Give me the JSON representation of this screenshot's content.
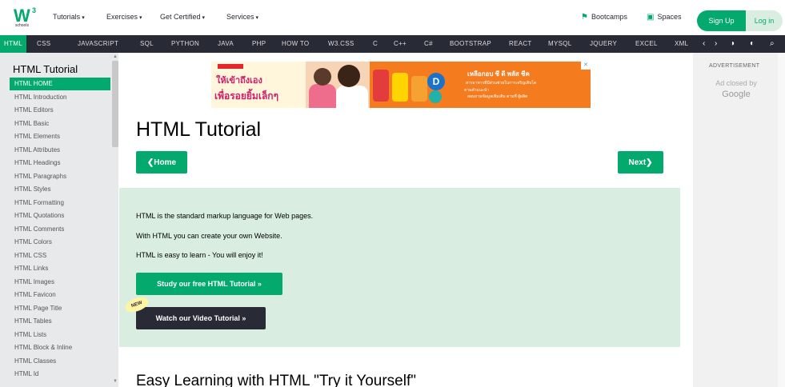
{
  "header": {
    "logo": {
      "text": "W",
      "sup": "3",
      "sub": "schools"
    },
    "menus": [
      {
        "label": "Tutorials",
        "caret": "▾"
      },
      {
        "label": "Exercises",
        "caret": "▾"
      },
      {
        "label": "Get Certified",
        "caret": "▾"
      },
      {
        "label": "Services",
        "caret": "▾"
      }
    ],
    "bootcamps": "Bootcamps",
    "spaces": "Spaces",
    "signup": "Sign Up",
    "login": "Log in"
  },
  "subjects": [
    "HTML",
    "CSS",
    "JAVASCRIPT",
    "SQL",
    "PYTHON",
    "JAVA",
    "PHP",
    "HOW TO",
    "W3.CSS",
    "C",
    "C++",
    "C#",
    "BOOTSTRAP",
    "REACT",
    "MYSQL",
    "JQUERY",
    "EXCEL",
    "XML"
  ],
  "bar_icons": {
    "prev": "‹",
    "next": "›",
    "theme": "◑",
    "extras": "◐",
    "search": "⌕"
  },
  "sidebar": {
    "title": "HTML Tutorial",
    "items": [
      "HTML HOME",
      "HTML Introduction",
      "HTML Editors",
      "HTML Basic",
      "HTML Elements",
      "HTML Attributes",
      "HTML Headings",
      "HTML Paragraphs",
      "HTML Styles",
      "HTML Formatting",
      "HTML Quotations",
      "HTML Comments",
      "HTML Colors",
      "HTML CSS",
      "HTML Links",
      "HTML Images",
      "HTML Favicon",
      "HTML Page Title",
      "HTML Tables",
      "HTML Lists",
      "HTML Block & Inline",
      "HTML Classes",
      "HTML Id"
    ],
    "active_index": 0,
    "scroll_up": "▲",
    "scroll_down": "▼"
  },
  "ad": {
    "left_line1": "ให้เข้าถึงเอง",
    "left_line2": "เพื่อรอยยิ้มเล็กๆ",
    "badge_letter": "D",
    "right_line1": "เหลือกอบ ซี ดี พลัส ชีค",
    "right_line2": "สารอาหารที่มีส่วนช่วยในการเจริญเติบโต",
    "right_line3": "ตามคำแนะนำ",
    "right_line4": "สอบถามข้อมูลเพิ่มเติม ตามที่ ผู้ผลิต",
    "close_mark": "✕"
  },
  "main": {
    "title": "HTML Tutorial",
    "home_button": "❮Home",
    "next_button": "Next❯",
    "intro_lines": [
      "HTML is the standard markup language for Web pages.",
      "With HTML you can create your own Website.",
      "HTML is easy to learn - You will enjoy it!"
    ],
    "study_button": "Study our free HTML Tutorial »",
    "video_button": "Watch our Video Tutorial »",
    "new_badge": "NEW",
    "section_heading": "Easy Learning with HTML \"Try it Yourself\""
  },
  "right_column": {
    "ad_label": "ADVERTISEMENT",
    "ad_closed": "Ad closed by",
    "ad_google": "Google"
  },
  "colors": {
    "brand": "#04aa6d",
    "dark": "#282a35",
    "light_green": "#d9eee1",
    "sidebar_bg": "#e7e9eb"
  }
}
